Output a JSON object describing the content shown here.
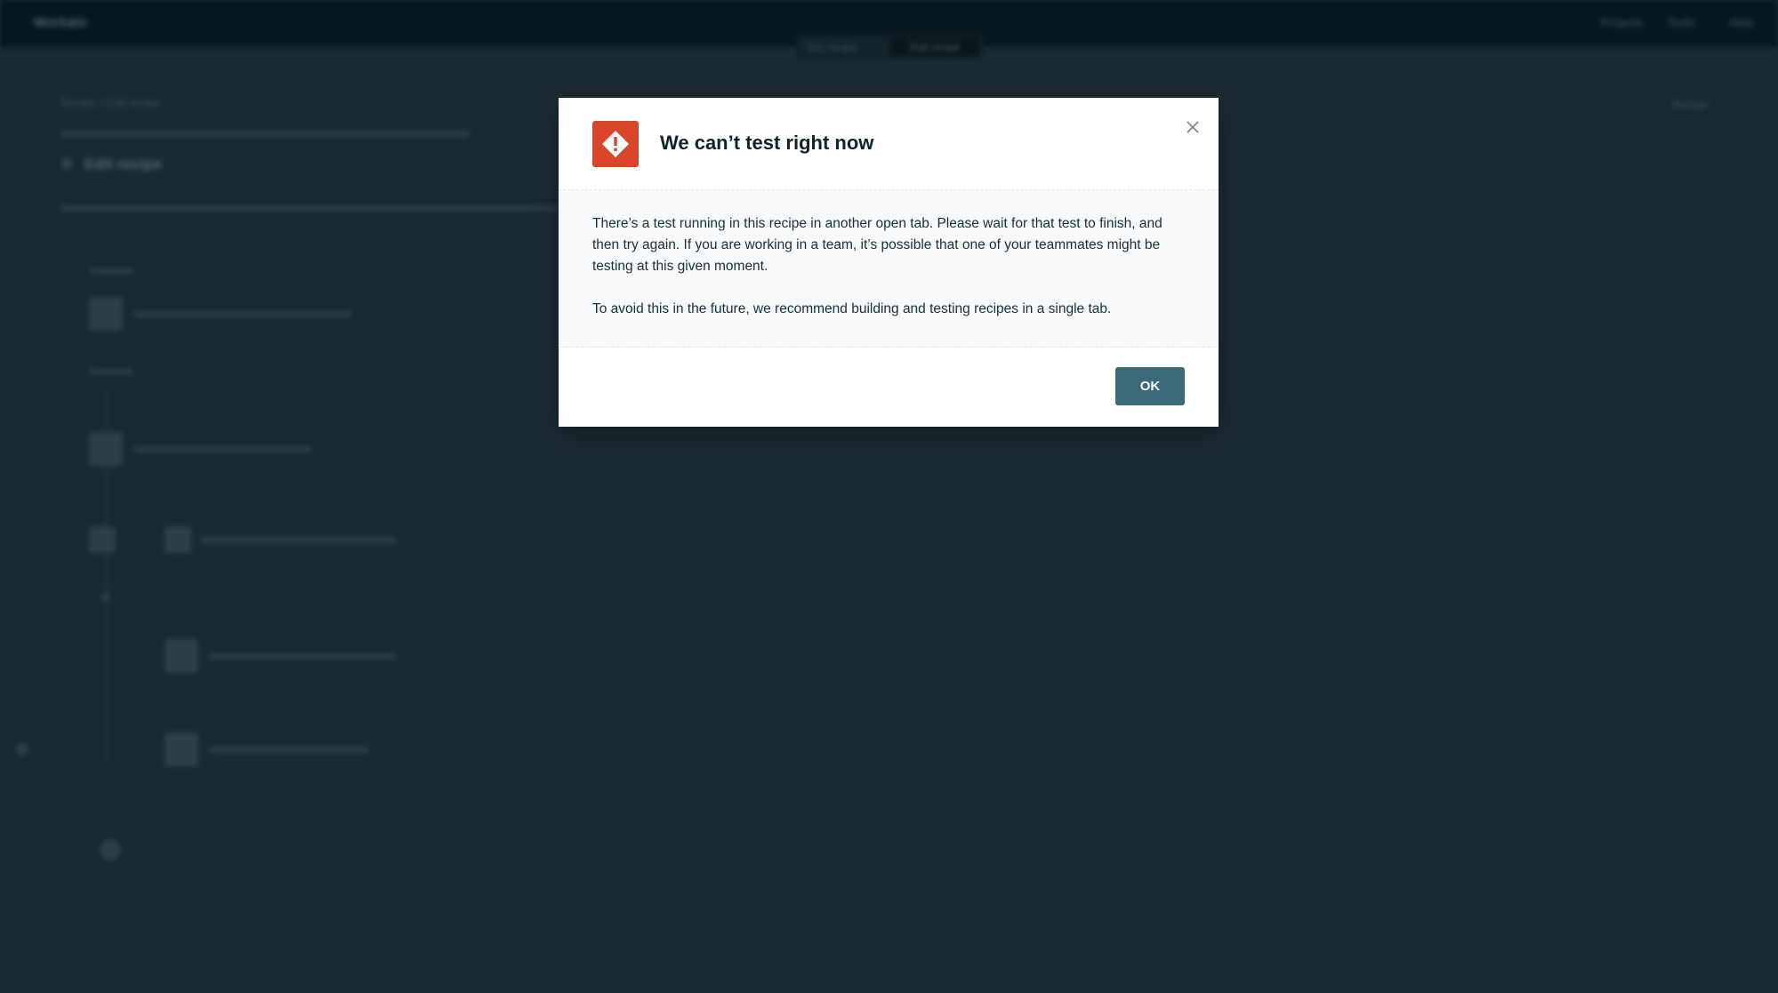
{
  "app": {
    "logo_text": "Workato",
    "nav": [
      "Projects",
      "Tools",
      "Help"
    ],
    "mode_left": "Test recipe",
    "mode_right": "Edit recipe",
    "breadcrumb": "Recipe / Edit recipe",
    "page_heading": "Edit recipe",
    "recipe_label": "Recipe"
  },
  "dialog": {
    "title": "We can’t test right now",
    "close_icon": "close-icon",
    "warning_icon": "warning-diamond-icon",
    "body_paragraph_1": "There’s a test running in this recipe in another open tab. Please wait for that test to finish, and then try again. If you are working in a team, it’s possible that one of your teammates might be testing at this given moment.",
    "body_paragraph_2": "To avoid this in the future, we recommend building and testing recipes in a single tab.",
    "ok_label": "OK"
  },
  "colors": {
    "accent_button": "#3a6a7a",
    "warning": "#d8452a",
    "overlay_bg": "#1c2a32"
  }
}
